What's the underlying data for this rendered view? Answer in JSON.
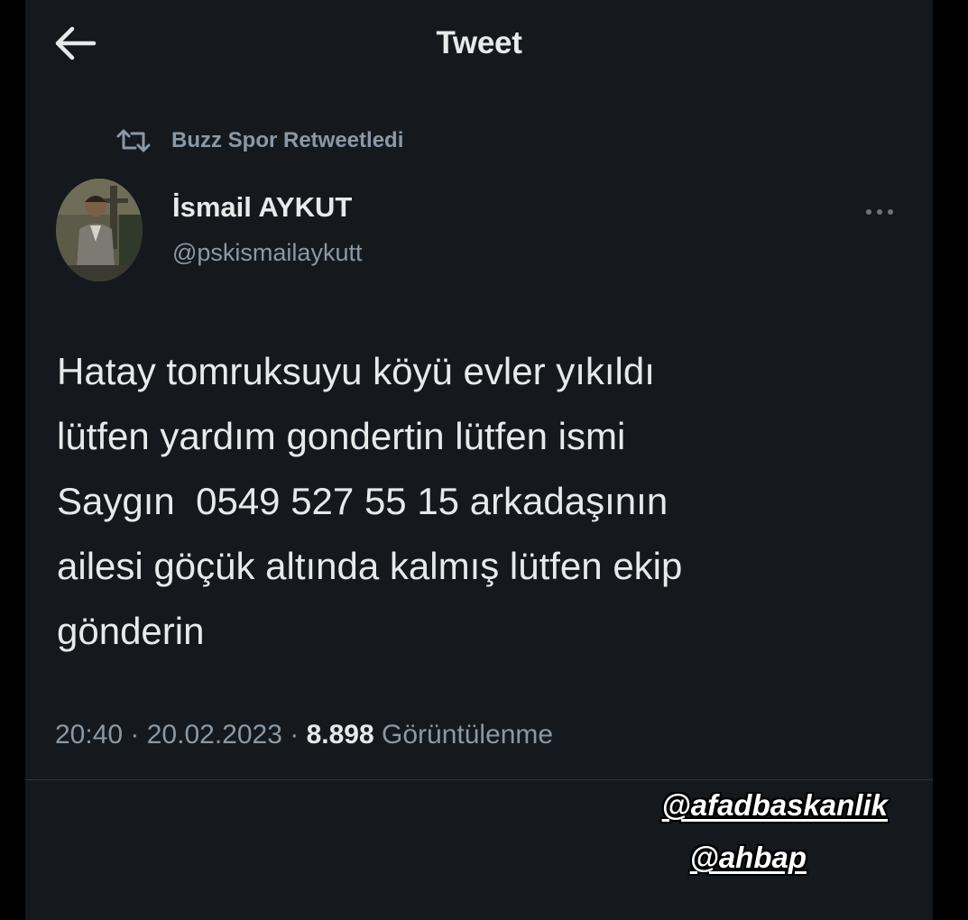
{
  "header": {
    "title": "Tweet",
    "back_icon": "arrow-left-icon"
  },
  "retweet": {
    "icon": "retweet-icon",
    "text": "Buzz Spor Retweetledi"
  },
  "author": {
    "name": "İsmail AYKUT",
    "handle": "@pskismailaykutt"
  },
  "more_icon": "more-horizontal-icon",
  "tweet": {
    "lines": [
      "Hatay tomruksuyu köyü evler yıkıldı",
      "lütfen yardım gondertin lütfen ismi",
      "Saygın  0549 527 55 15 arkadaşının",
      "ailesi göçük altında kalmış lütfen ekip",
      "gönderin"
    ]
  },
  "meta": {
    "time": "20:40",
    "separator": " · ",
    "date": "20.02.2023",
    "views_count": "8.898",
    "views_label": "Görüntülenme"
  },
  "mentions": [
    "@afadbaskanlik",
    "@ahbap"
  ],
  "colors": {
    "background": "#15181d",
    "primary_text": "#e7e9ea",
    "secondary_text": "#8b98a5",
    "divider": "#2f3336"
  }
}
